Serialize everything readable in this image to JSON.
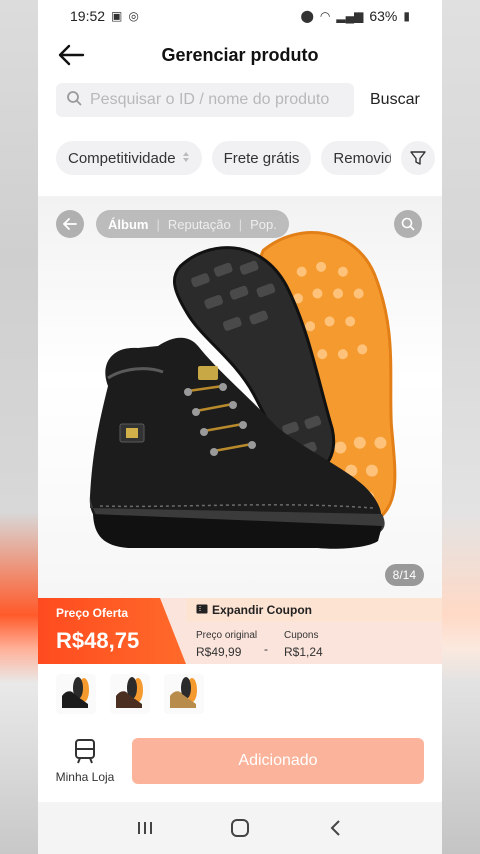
{
  "status_bar": {
    "time": "19:52",
    "battery": "63%"
  },
  "header": {
    "title": "Gerenciar produto"
  },
  "search": {
    "placeholder": "Pesquisar o ID / nome do produto",
    "button_label": "Buscar"
  },
  "filters": {
    "chips": [
      "Competitividade",
      "Frete grátis",
      "Removid"
    ]
  },
  "image_viewer": {
    "tabs": [
      "Álbum",
      "Reputação",
      "Pop."
    ],
    "counter": "8/14"
  },
  "price": {
    "offer_label": "Preço Oferta",
    "offer_value": "R$48,75",
    "coupon_title": "Expandir Coupon",
    "original_label": "Preço original",
    "original_value": "R$49,99",
    "separator": "-",
    "coupons_label": "Cupons",
    "coupons_value": "R$1,24"
  },
  "thumbnails": [
    "black-boot",
    "brown-boot",
    "tan-boot"
  ],
  "actions": {
    "store_label": "Minha Loja",
    "add_label": "Adicionado"
  },
  "colors": {
    "accent": "#ff4b1f",
    "add_button": "#fbb49b",
    "band": "#fbe4dc"
  }
}
